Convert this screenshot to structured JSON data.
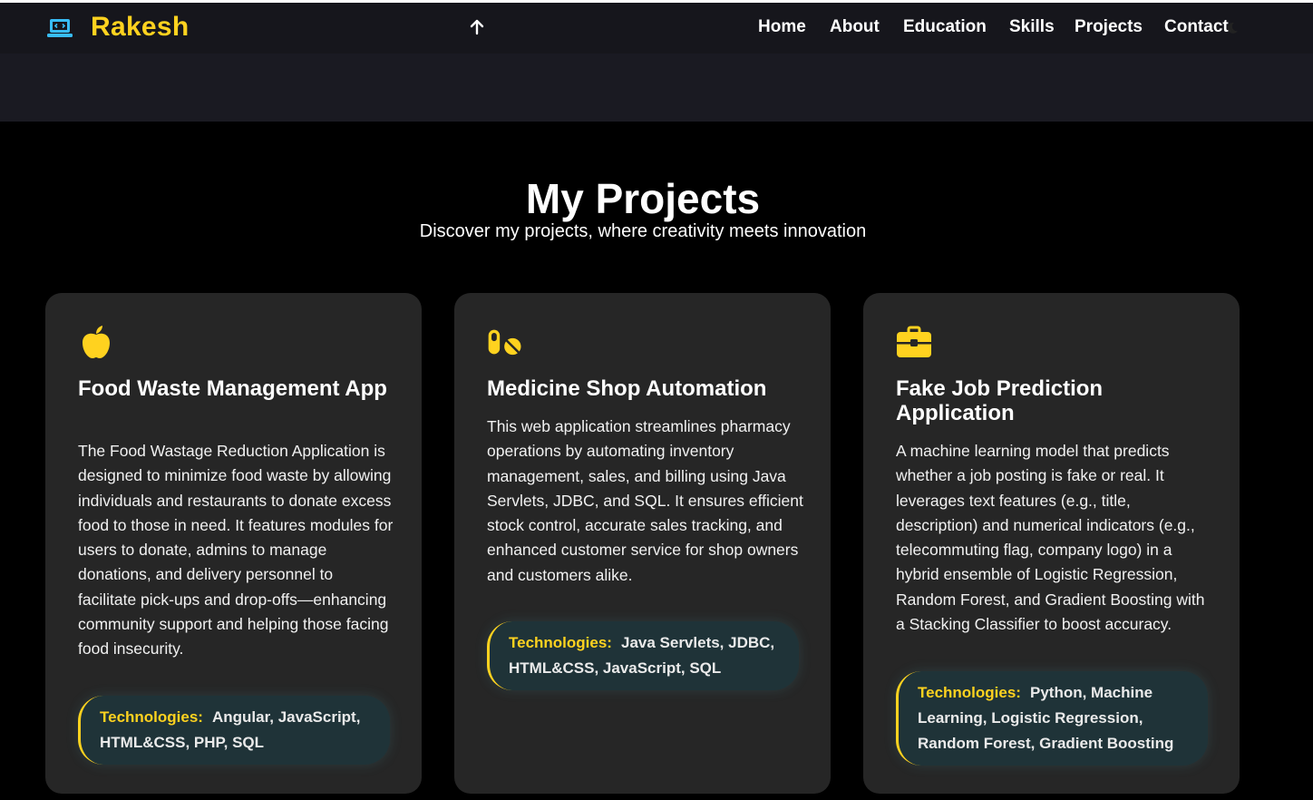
{
  "brand": {
    "name": "Rakesh",
    "icon": "laptop-code-icon"
  },
  "scroll_top_icon": "arrow-up-icon",
  "nav": {
    "items": [
      {
        "label": "Home"
      },
      {
        "label": "About"
      },
      {
        "label": "Education"
      },
      {
        "label": "Skills"
      },
      {
        "label": "Projects"
      },
      {
        "label": "Contact"
      }
    ],
    "theme_icon": "moon-icon"
  },
  "section": {
    "title": "My Projects",
    "subtitle": "Discover my projects, where creativity meets innovation"
  },
  "projects": [
    {
      "icon": "apple-icon",
      "title": "Food Waste Management App",
      "description": "The Food Wastage Reduction Application is designed to minimize food waste by allowing individuals and restaurants to donate excess food to those in need. It features modules for users to donate, admins to manage donations, and delivery personnel to facilitate pick-ups and drop-offs—enhancing community support and helping those facing food insecurity.",
      "tech_label": "Technologies:",
      "tech": "Angular, JavaScript, HTML&CSS, PHP, SQL"
    },
    {
      "icon": "pills-icon",
      "title": "Medicine Shop Automation",
      "description": "This web application streamlines pharmacy operations by automating inventory management, sales, and billing using Java Servlets, JDBC, and SQL. It ensures efficient stock control, accurate sales tracking, and enhanced customer service for shop owners and customers alike.",
      "tech_label": "Technologies:",
      "tech": "Java Servlets, JDBC, HTML&CSS, JavaScript, SQL"
    },
    {
      "icon": "briefcase-icon",
      "title": "Fake Job Prediction Application",
      "description": "A machine learning model that predicts whether a job posting is fake or real. It leverages text features (e.g., title, description) and numerical indicators (e.g., telecommuting flag, company logo) in a hybrid ensemble of Logistic Regression, Random Forest, and Gradient Boosting with a Stacking Classifier to boost accuracy.",
      "tech_label": "Technologies:",
      "tech": "Python, Machine Learning, Logistic Regression, Random Forest, Gradient Boosting"
    }
  ],
  "colors": {
    "accent": "#ffd21f",
    "brand_icon": "#38bdf8",
    "card_bg": "#262626",
    "tech_bg": "#1f3338"
  }
}
